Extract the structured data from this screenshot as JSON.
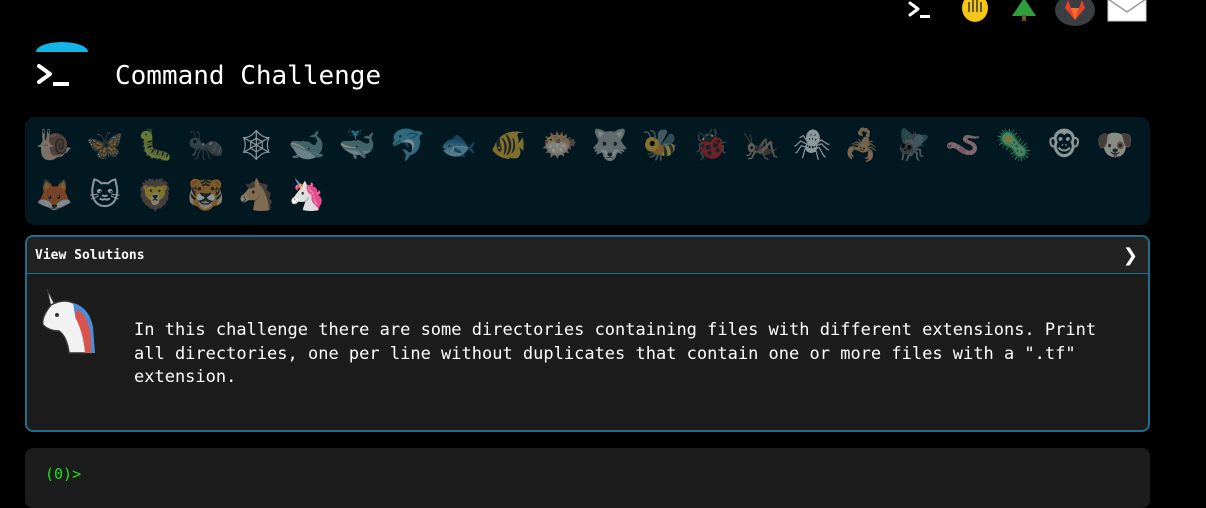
{
  "header": {
    "title": "Command Challenge",
    "top_icons": [
      "terminal-icon",
      "hand-icon",
      "tree-icon",
      "gitlab-icon",
      "mail-icon"
    ]
  },
  "challenges": {
    "emojis": [
      {
        "name": "snail",
        "glyph": "🐌"
      },
      {
        "name": "butterfly",
        "glyph": "🦋"
      },
      {
        "name": "caterpillar",
        "glyph": "🐛"
      },
      {
        "name": "ant",
        "glyph": "🐜"
      },
      {
        "name": "spider-web",
        "glyph": "🕸"
      },
      {
        "name": "whale",
        "glyph": "🐋"
      },
      {
        "name": "spouting-whale",
        "glyph": "🐳"
      },
      {
        "name": "dolphin",
        "glyph": "🐬"
      },
      {
        "name": "fish",
        "glyph": "🐟"
      },
      {
        "name": "tropical-fish",
        "glyph": "🐠"
      },
      {
        "name": "blowfish",
        "glyph": "🐡"
      },
      {
        "name": "wolf",
        "glyph": "🐺"
      },
      {
        "name": "bee",
        "glyph": "🐝"
      },
      {
        "name": "ladybug",
        "glyph": "🐞"
      },
      {
        "name": "cricket",
        "glyph": "🦗"
      },
      {
        "name": "spider",
        "glyph": "🕷"
      },
      {
        "name": "scorpion",
        "glyph": "🦂"
      },
      {
        "name": "fly",
        "glyph": "🪰"
      },
      {
        "name": "worm",
        "glyph": "🪱"
      },
      {
        "name": "microbe",
        "glyph": "🦠"
      },
      {
        "name": "monkey",
        "glyph": "🐵"
      },
      {
        "name": "dog",
        "glyph": "🐶"
      },
      {
        "name": "fox",
        "glyph": "🦊"
      },
      {
        "name": "cat",
        "glyph": "🐱"
      },
      {
        "name": "lion",
        "glyph": "🦁"
      },
      {
        "name": "tiger",
        "glyph": "🐯"
      },
      {
        "name": "horse",
        "glyph": "🐴"
      },
      {
        "name": "unicorn",
        "glyph": "🦄",
        "active": true
      }
    ]
  },
  "solutions_panel": {
    "title": "View Solutions",
    "chevron": "❯",
    "description": "In this challenge there are some directories containing files with different extensions. Print all directories, one per line without duplicates that contain one or more files with a \".tf\" extension."
  },
  "terminal": {
    "prompt": "(0)>"
  },
  "colors": {
    "background": "#000000",
    "emoji_panel_bg": "#011820",
    "panel_border": "#1d6f8c",
    "panel_bg": "#1c1c1c",
    "prompt_green": "#19e619",
    "logo_cyan": "#14b4e6"
  }
}
